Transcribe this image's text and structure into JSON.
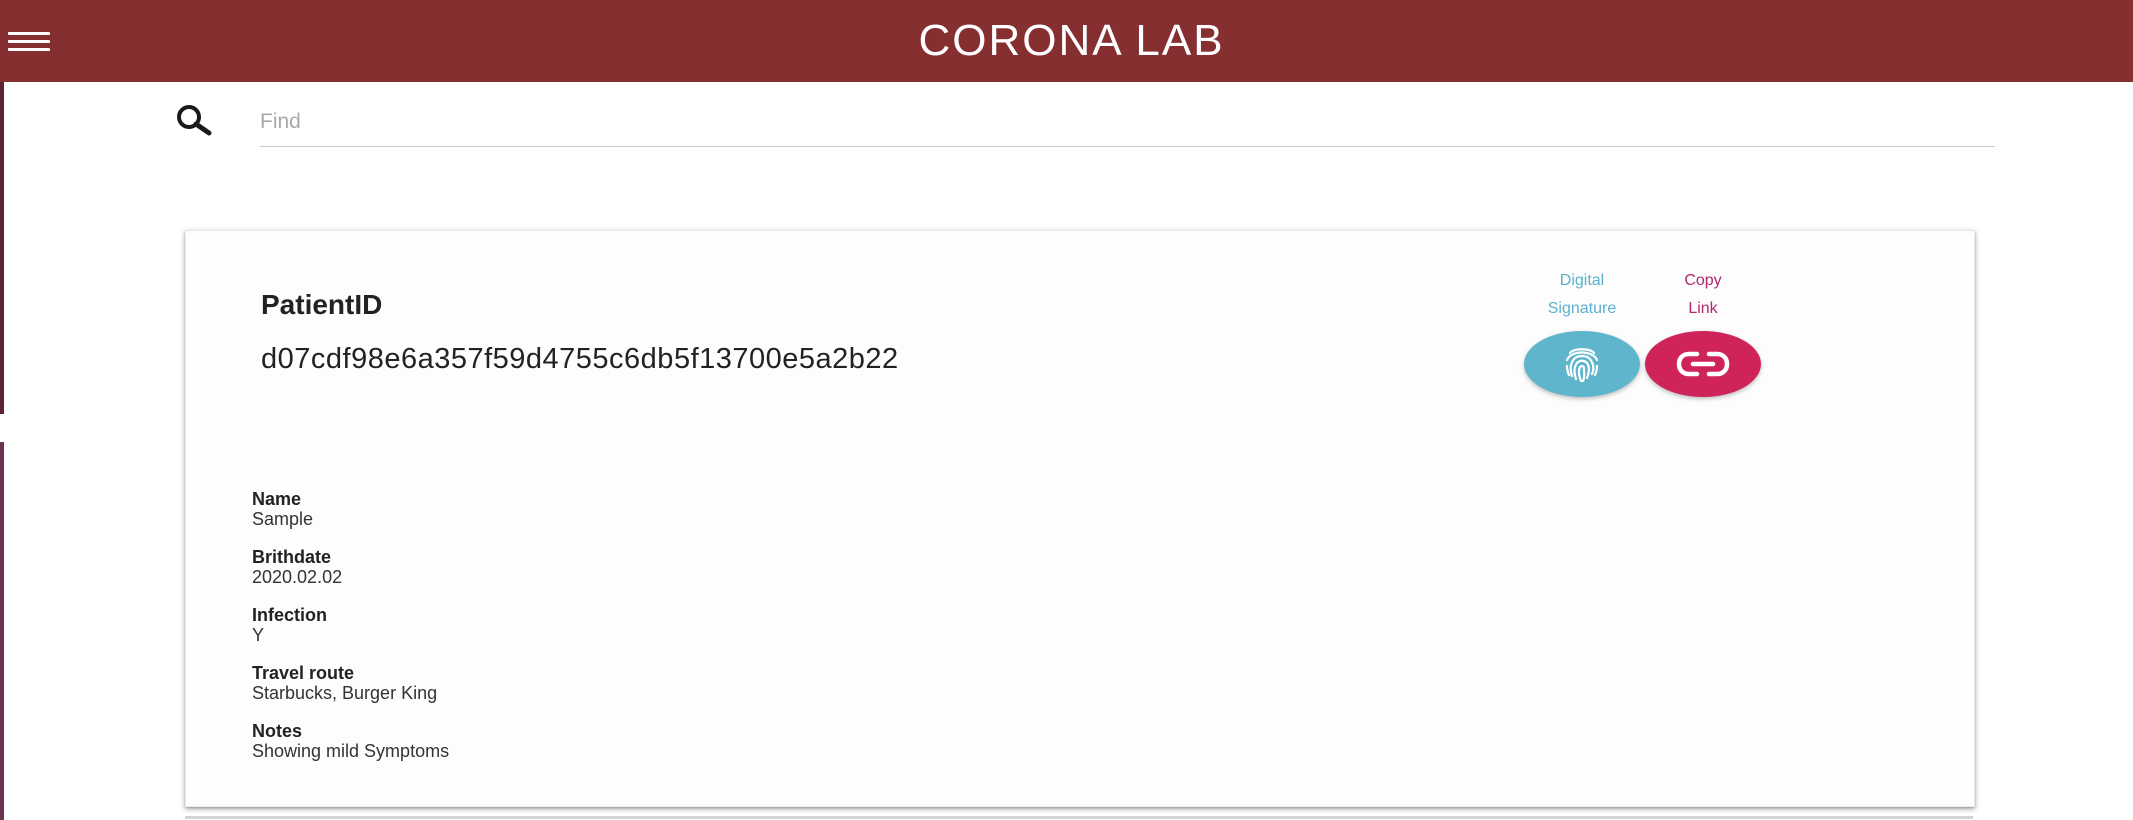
{
  "header": {
    "title": "CORONA LAB",
    "menu_icon": "hamburger-menu-icon"
  },
  "search": {
    "placeholder": "Find",
    "value": "",
    "icon": "search-icon"
  },
  "patient": {
    "id_label": "PatientID",
    "id_value": "d07cdf98e6a357f59d4755c6db5f13700e5a2b22"
  },
  "actions": {
    "digital_signature": {
      "label_line1": "Digital",
      "label_line2": "Signature",
      "icon": "fingerprint-icon",
      "color": "#5fb6cc"
    },
    "copy_link": {
      "label_line1": "Copy",
      "label_line2": "Link",
      "icon": "link-icon",
      "color": "#cf2459"
    }
  },
  "fields": [
    {
      "label": "Name",
      "value": "Sample"
    },
    {
      "label": "Brithdate",
      "value": "2020.02.02"
    },
    {
      "label": "Infection",
      "value": "Y"
    },
    {
      "label": "Travel route",
      "value": "Starbucks, Burger King"
    },
    {
      "label": "Notes",
      "value": "Showing mild Symptoms"
    }
  ],
  "colors": {
    "header_bg": "#862f30",
    "header_text": "#ffffff"
  }
}
